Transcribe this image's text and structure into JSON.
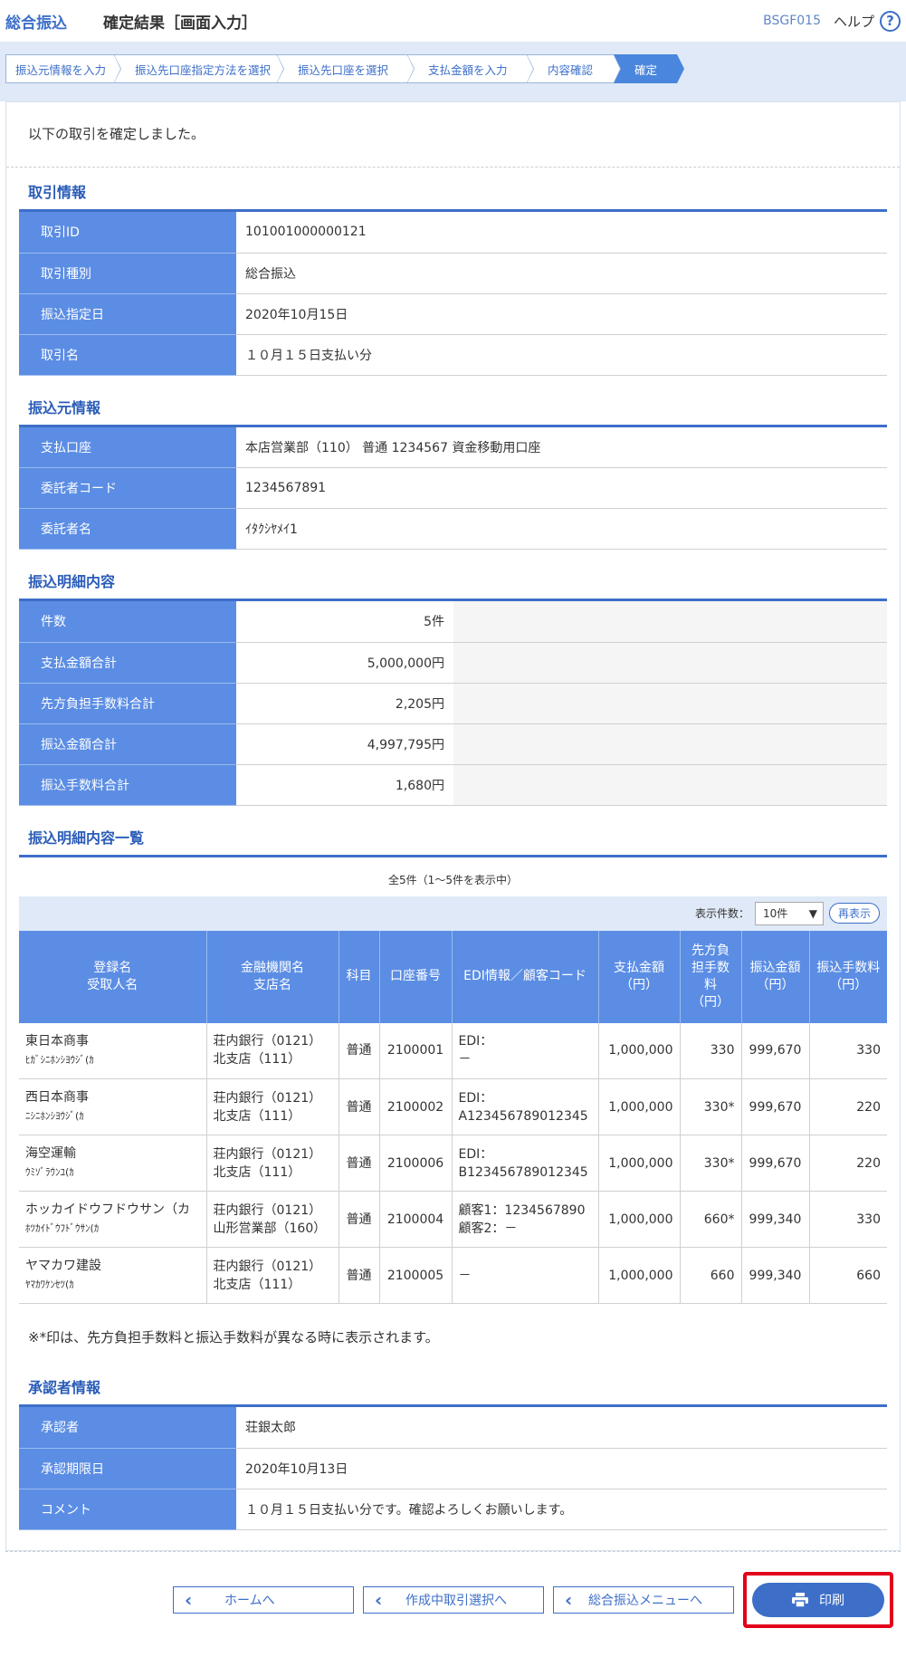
{
  "header": {
    "category": "総合振込",
    "title": "確定結果［画面入力］",
    "screen_code": "BSGF015",
    "help": "ヘルプ",
    "help_icon": "?"
  },
  "steps": [
    "振込元情報を入力",
    "振込先口座指定方法を選択",
    "振込先口座を選択",
    "支払金額を入力",
    "内容確認",
    "確定"
  ],
  "message": "以下の取引を確定しました。",
  "transaction": {
    "title": "取引情報",
    "rows": [
      {
        "k": "取引ID",
        "v": "101001000000121"
      },
      {
        "k": "取引種別",
        "v": "総合振込"
      },
      {
        "k": "振込指定日",
        "v": "2020年10月15日"
      },
      {
        "k": "取引名",
        "v": "１０月１５日支払い分"
      }
    ]
  },
  "source": {
    "title": "振込元情報",
    "rows": [
      {
        "k": "支払口座",
        "v": "本店営業部（110） 普通 1234567 資金移動用口座"
      },
      {
        "k": "委託者コード",
        "v": "1234567891"
      },
      {
        "k": "委託者名",
        "v": "ｲﾀｸｼﾔﾒｲ1"
      }
    ]
  },
  "summary": {
    "title": "振込明細内容",
    "rows": [
      {
        "k": "件数",
        "v": "5件"
      },
      {
        "k": "支払金額合計",
        "v": "5,000,000円"
      },
      {
        "k": "先方負担手数料合計",
        "v": "2,205円"
      },
      {
        "k": "振込金額合計",
        "v": "4,997,795円"
      },
      {
        "k": "振込手数料合計",
        "v": "1,680円"
      }
    ]
  },
  "list": {
    "title": "振込明細内容一覧",
    "count": "全5件（1～5件を表示中）",
    "display_label": "表示件数：",
    "display_value": "10件",
    "redisplay": "再表示",
    "headers": {
      "name1": "登録名",
      "name2": "受取人名",
      "bank1": "金融機関名",
      "bank2": "支店名",
      "type": "科目",
      "acct": "口座番号",
      "edi": "EDI情報／顧客コード",
      "pay1": "支払金額",
      "pay2": "（円）",
      "fee1": "先方負",
      "fee2": "担手数",
      "fee3": "料",
      "fee4": "（円）",
      "amt1": "振込金額",
      "amt2": "（円）",
      "tf1": "振込手数料",
      "tf2": "（円）"
    },
    "rows": [
      {
        "name": "東日本商事",
        "kana": "ﾋｶﾞｼﾆﾎﾝｼﾖｳｼﾞ(ｶ",
        "bank": "荘内銀行（0121）",
        "branch": "北支店（111）",
        "type": "普通",
        "acct": "2100001",
        "edi1": "EDI：",
        "edi2": "－",
        "pay": "1,000,000",
        "fee": "330",
        "amt": "999,670",
        "tf": "330"
      },
      {
        "name": "西日本商事",
        "kana": "ﾆｼﾆﾎﾝｼﾖｳｼﾞ(ｶ",
        "bank": "荘内銀行（0121）",
        "branch": "北支店（111）",
        "type": "普通",
        "acct": "2100002",
        "edi1": "EDI：",
        "edi2": "A123456789012345",
        "pay": "1,000,000",
        "fee": "330*",
        "amt": "999,670",
        "tf": "220"
      },
      {
        "name": "海空運輸",
        "kana": "ｳﾐｿﾞﾗｳﾝﾕ(ｶ",
        "bank": "荘内銀行（0121）",
        "branch": "北支店（111）",
        "type": "普通",
        "acct": "2100006",
        "edi1": "EDI：",
        "edi2": "B123456789012345",
        "pay": "1,000,000",
        "fee": "330*",
        "amt": "999,670",
        "tf": "220"
      },
      {
        "name": "ホッカイドウフドウサン（カ",
        "kana": "ﾎﾂｶｲﾄﾞｳﾌﾄﾞｳｻﾝ(ｶ",
        "bank": "荘内銀行（0121）",
        "branch": "山形営業部（160）",
        "type": "普通",
        "acct": "2100004",
        "edi1": "顧客1：1234567890",
        "edi2": "顧客2：－",
        "pay": "1,000,000",
        "fee": "660*",
        "amt": "999,340",
        "tf": "330"
      },
      {
        "name": "ヤマカワ建設",
        "kana": "ﾔﾏｶﾜｹﾝｾﾂ(ｶ",
        "bank": "荘内銀行（0121）",
        "branch": "北支店（111）",
        "type": "普通",
        "acct": "2100005",
        "edi1": "－",
        "edi2": "",
        "pay": "1,000,000",
        "fee": "660",
        "amt": "999,340",
        "tf": "660"
      }
    ]
  },
  "note": "※*印は、先方負担手数料と振込手数料が異なる時に表示されます。",
  "approver": {
    "title": "承認者情報",
    "rows": [
      {
        "k": "承認者",
        "v": "荘銀太郎"
      },
      {
        "k": "承認期限日",
        "v": "2020年10月13日"
      },
      {
        "k": "コメント",
        "v": "１０月１５日支払い分です。確認よろしくお願いします。"
      }
    ]
  },
  "buttons": {
    "home": "ホームへ",
    "in_progress": "作成中取引選択へ",
    "menu": "総合振込メニューへ",
    "print": "印刷"
  },
  "colors": {
    "accent": "#3d6fc9",
    "header_cell": "#5b8de4",
    "highlight": "#e3001b"
  }
}
